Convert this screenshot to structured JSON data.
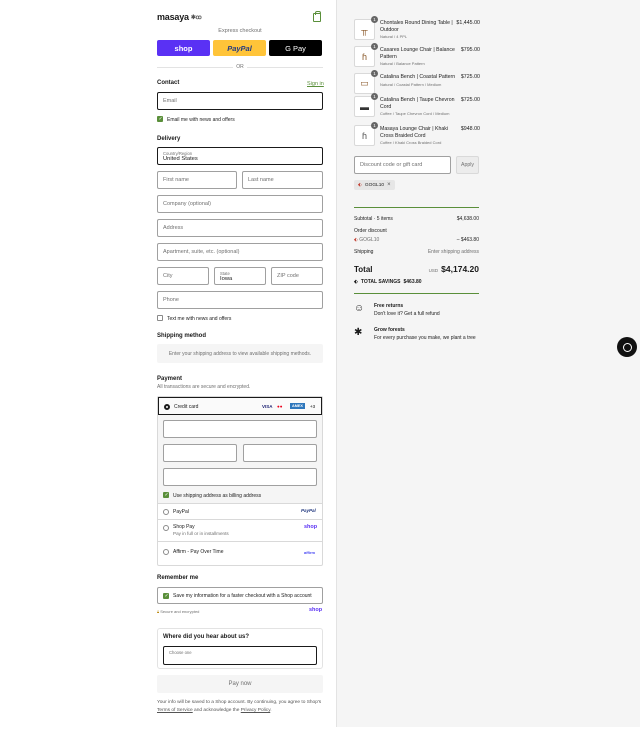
{
  "brand": {
    "name": "masaya",
    "mark": "✱ꝏ"
  },
  "express": {
    "label": "Express checkout",
    "shop": "shop",
    "paypal": "PayPal",
    "gpay": "G Pay",
    "or": "OR"
  },
  "contact": {
    "heading": "Contact",
    "sign_in": "Sign in",
    "email_placeholder": "Email",
    "news_label": "Email me with news and offers"
  },
  "delivery": {
    "heading": "Delivery",
    "country_label": "Country/Region",
    "country_value": "United States",
    "first_name": "First name",
    "last_name": "Last name",
    "company": "Company (optional)",
    "address": "Address",
    "apartment": "Apartment, suite, etc. (optional)",
    "city": "City",
    "state_label": "State",
    "state_value": "Iowa",
    "zip": "ZIP code",
    "phone": "Phone",
    "text_label": "Text me with news and offers"
  },
  "shipping": {
    "heading": "Shipping method",
    "message": "Enter your shipping address to view available shipping methods."
  },
  "payment": {
    "heading": "Payment",
    "sub": "All transactions are secure and encrypted.",
    "credit_card": "Credit card",
    "card_brands": [
      "VISA",
      "●●",
      "AMEX",
      "+3"
    ],
    "billing_label": "Use shipping address as billing address",
    "paypal": "PayPal",
    "paypal_logo": "PayPal",
    "shop_pay": "Shop Pay",
    "shop_pay_sub": "Pay in full or in installments",
    "shop_pay_logo": "shop",
    "affirm": "Affirm - Pay Over Time",
    "affirm_logo": "affirm"
  },
  "remember": {
    "heading": "Remember me",
    "save_label": "Save my information for a faster checkout with a Shop account",
    "secure": "Secure and encrypted",
    "shop_logo": "shop"
  },
  "survey": {
    "heading": "Where did you hear about us?",
    "select_label": "Choose one"
  },
  "pay_now": "Pay now",
  "terms": {
    "pre": "Your info will be saved to a Shop account. By continuing, you agree to Shop's ",
    "tos": "Terms of Service",
    "mid": " and acknowledge the ",
    "privacy": "Privacy Policy",
    "post": "."
  },
  "items": [
    {
      "qty": "1",
      "name": "Chontales Round Dining Table | Outdoor",
      "variant": "Natural / 4 PPL",
      "price": "$1,445.00"
    },
    {
      "qty": "1",
      "name": "Casares Lounge Chair | Balance Pattern",
      "variant": "Natural / Balance Pattern",
      "price": "$795.00"
    },
    {
      "qty": "1",
      "name": "Catalina Bench | Coastal Pattern",
      "variant": "Natural / Coastal Pattern / Medium",
      "price": "$725.00"
    },
    {
      "qty": "1",
      "name": "Catalina Bench | Taupe Chevron Cord",
      "variant": "Coffee / Taupe Chevron Cord / Medium",
      "price": "$725.00"
    },
    {
      "qty": "1",
      "name": "Masaya Lounge Chair | Khaki Cross Braided Cord",
      "variant": "Coffee / Khaki Cross Braided Cord",
      "price": "$948.00"
    }
  ],
  "discount": {
    "placeholder": "Discount code or gift card",
    "apply": "Apply",
    "code": "GOGL10"
  },
  "summary": {
    "subtotal_label": "Subtotal · 5 items",
    "subtotal": "$4,638.00",
    "order_discount": "Order discount",
    "code": "GOGL10",
    "discount_amount": "– $463.80",
    "shipping_label": "Shipping",
    "shipping_value": "Enter shipping address",
    "total_label": "Total",
    "currency": "USD",
    "total": "$4,174.20",
    "savings_label": "TOTAL SAVINGS",
    "savings": "$463.80"
  },
  "perks": [
    {
      "icon": "☺",
      "title": "Free returns",
      "sub": "Don't love it? Get a full refund"
    },
    {
      "icon": "✱",
      "title": "Grow forests",
      "sub": "For every purchase you make, we plant a tree"
    }
  ]
}
